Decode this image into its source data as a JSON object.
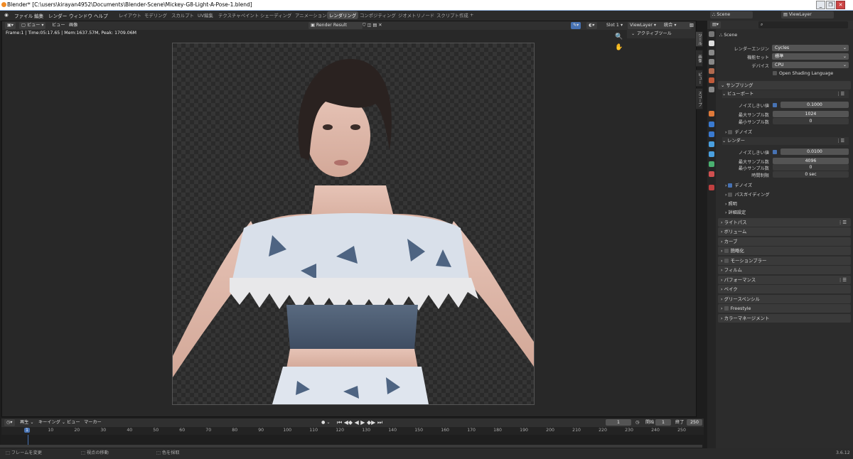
{
  "titlebar": {
    "text": "Blender* [C:\\users\\kirayan4952\\Documents\\Blender-Scene\\Mickey-G8-Light-A-Pose-1.blend]"
  },
  "menu": [
    "ファイル",
    "編集",
    "レンダー",
    "ウィンドウ",
    "ヘルプ"
  ],
  "workspaces": [
    "レイアウト",
    "モデリング",
    "スカルプト",
    "UV編集",
    "テクスチャペイント",
    "シェーディング",
    "アニメーション",
    "レンダリング",
    "コンポジティング",
    "ジオメトリノード",
    "スクリプト作成",
    "+"
  ],
  "active_workspace": "レンダリング",
  "viewer": {
    "menu": [
      "ビュー",
      "ビュー",
      "画像"
    ],
    "image_name": "Render Result",
    "slot": "Slot 1",
    "view_layer": "ViewLayer",
    "pass": "統合",
    "stats": "Frame:1 | Time:05:17.65 | Mem:1637.57M, Peak: 1709.06M",
    "sidebar_title": "アクティブツール",
    "tabs": [
      "ツール",
      "画像",
      "ビュー",
      "スコープ"
    ]
  },
  "outliner": {
    "scene": "Scene",
    "view_layer": "ViewLayer"
  },
  "properties": {
    "scene": "Scene",
    "render_engine_label": "レンダーエンジン",
    "render_engine": "Cycles",
    "feature_set_label": "機能セット",
    "feature_set": "標準",
    "device_label": "デバイス",
    "device": "CPU",
    "osl": "Open Shading Language",
    "sampling": "サンプリング",
    "viewport": "ビューポート",
    "noise_threshold_label": "ノイズしきい値",
    "vp_noise": "0.1000",
    "max_samples_label": "最大サンプル数",
    "vp_max": "1024",
    "min_samples_label": "最小サンプル数",
    "vp_min": "0",
    "denoise": "デノイズ",
    "render": "レンダー",
    "r_noise": "0.0100",
    "r_max": "4096",
    "r_min": "0",
    "time_limit_label": "時間制限",
    "r_time": "0 sec",
    "path_guiding": "パスガイディング",
    "lights": "照明",
    "advanced": "詳細設定",
    "sections": [
      "ライトパス",
      "ボリューム",
      "カーブ",
      "簡略化",
      "モーションブラー",
      "フィルム",
      "パフォーマンス",
      "ベイク",
      "グリースペンシル",
      "Freestyle",
      "カラーマネージメント"
    ]
  },
  "timeline": {
    "menu": [
      "再生",
      "キーイング",
      "ビュー",
      "マーカー"
    ],
    "current_frame": "1",
    "start_label": "開始",
    "start": "1",
    "end_label": "終了",
    "end": "250",
    "ticks": [
      "1",
      "10",
      "20",
      "30",
      "40",
      "50",
      "60",
      "70",
      "80",
      "90",
      "100",
      "110",
      "120",
      "130",
      "140",
      "150",
      "160",
      "170",
      "180",
      "190",
      "200",
      "210",
      "220",
      "230",
      "240",
      "250"
    ]
  },
  "status": {
    "left": "フレームを変更",
    "mid": "視点の移動",
    "right": "色を採取",
    "version": "3.6.12"
  }
}
